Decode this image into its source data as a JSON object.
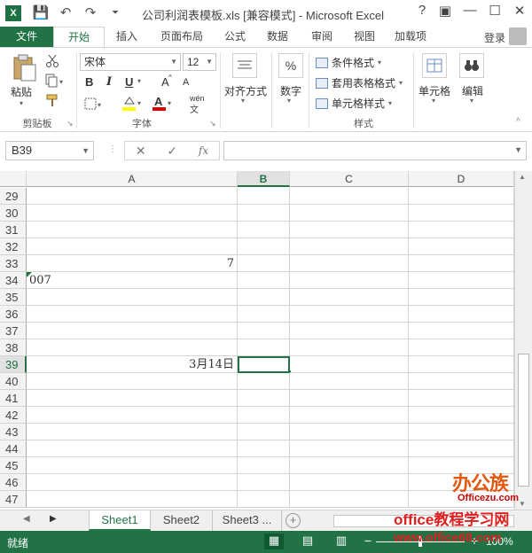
{
  "window": {
    "title": "公司利润表模板.xls  [兼容模式] - Microsoft Excel",
    "app_logo": "X",
    "controls": [
      "?",
      "▣",
      "—",
      "☐",
      "✕"
    ]
  },
  "qat": {
    "save_icon": "💾",
    "undo_icon": "↶",
    "redo_icon": "↷",
    "customize_icon": "⏷"
  },
  "tabs": [
    {
      "label": "文件"
    },
    {
      "label": "开始"
    },
    {
      "label": "插入"
    },
    {
      "label": "页面布局"
    },
    {
      "label": "公式"
    },
    {
      "label": "数据"
    },
    {
      "label": "审阅"
    },
    {
      "label": "视图"
    },
    {
      "label": "加载项"
    }
  ],
  "login_label": "登录",
  "ribbon": {
    "clipboard": {
      "paste_label": "粘贴",
      "group_label": "剪贴板"
    },
    "font": {
      "font_name": "宋体",
      "font_size": "12",
      "bold": "B",
      "italic": "I",
      "underline": "U",
      "grow": "A",
      "shrink": "A",
      "font_color": "A",
      "wen": "wén",
      "group_label": "字体"
    },
    "alignment": {
      "label": "对齐方式"
    },
    "number": {
      "label": "数字",
      "icon": "%"
    },
    "styles": {
      "conditional": "条件格式",
      "table": "套用表格格式",
      "cell": "单元格样式",
      "group_label": "样式"
    },
    "cells": {
      "label": "单元格"
    },
    "editing": {
      "label": "编辑"
    }
  },
  "formula_bar": {
    "name_box": "B39",
    "cancel_icon": "✕",
    "enter_icon": "✓",
    "fx_label": "fx",
    "value": ""
  },
  "columns": [
    {
      "label": "A",
      "selected": false
    },
    {
      "label": "B",
      "selected": true
    },
    {
      "label": "C",
      "selected": false
    },
    {
      "label": "D",
      "selected": false
    }
  ],
  "rows": [
    {
      "num": "29",
      "a": "",
      "selected": false
    },
    {
      "num": "30",
      "a": "",
      "selected": false
    },
    {
      "num": "31",
      "a": "",
      "selected": false
    },
    {
      "num": "32",
      "a": "",
      "selected": false
    },
    {
      "num": "33",
      "a": "7",
      "align": "right",
      "selected": false
    },
    {
      "num": "34",
      "a": "007",
      "align": "left",
      "error_flag": true,
      "selected": false
    },
    {
      "num": "35",
      "a": "",
      "selected": false
    },
    {
      "num": "36",
      "a": "",
      "selected": false
    },
    {
      "num": "37",
      "a": "",
      "selected": false
    },
    {
      "num": "38",
      "a": "",
      "selected": false
    },
    {
      "num": "39",
      "a": "3月14日",
      "align": "right",
      "selected": true
    },
    {
      "num": "40",
      "a": "",
      "selected": false
    },
    {
      "num": "41",
      "a": "",
      "selected": false
    },
    {
      "num": "42",
      "a": "",
      "selected": false
    },
    {
      "num": "43",
      "a": "",
      "selected": false
    },
    {
      "num": "44",
      "a": "",
      "selected": false
    },
    {
      "num": "45",
      "a": "",
      "selected": false
    },
    {
      "num": "46",
      "a": "",
      "selected": false
    },
    {
      "num": "47",
      "a": "",
      "selected": false
    }
  ],
  "sheets": [
    {
      "label": "Sheet1",
      "active": true
    },
    {
      "label": "Sheet2",
      "active": false
    },
    {
      "label": "Sheet3 ...",
      "active": false
    }
  ],
  "status": {
    "ready": "就绪",
    "zoom": "100%"
  },
  "watermark": {
    "logo": "办公族",
    "logo_sub": "Officezu.com",
    "text": "office教程学习网",
    "url": "www.office68.com"
  },
  "colors": {
    "excel_green": "#217346",
    "watermark_red": "#e02020"
  }
}
